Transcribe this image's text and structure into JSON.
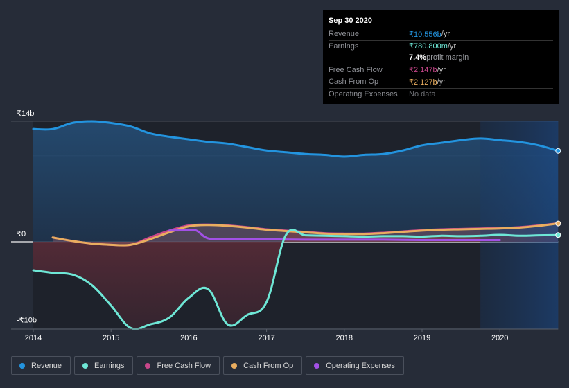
{
  "tooltip": {
    "date": "Sep 30 2020",
    "rows": [
      {
        "label": "Revenue",
        "value": "₹10.556b",
        "unit": " /yr",
        "color": "#2394df"
      },
      {
        "label": "Earnings",
        "value": "₹780.800m",
        "unit": " /yr",
        "color": "#6ee7d6"
      },
      {
        "label": "",
        "value": "7.4%",
        "unit": " profit margin",
        "color": "#ffffff"
      },
      {
        "label": "Free Cash Flow",
        "value": "₹2.147b",
        "unit": " /yr",
        "color": "#c8468a"
      },
      {
        "label": "Cash From Op",
        "value": "₹2.127b",
        "unit": " /yr",
        "color": "#e9ad5f"
      },
      {
        "label": "Operating Expenses",
        "value": "No data",
        "unit": "",
        "color": "#6c6e73"
      }
    ]
  },
  "legend": [
    {
      "label": "Revenue",
      "color": "#2394df"
    },
    {
      "label": "Earnings",
      "color": "#6ee7d6"
    },
    {
      "label": "Free Cash Flow",
      "color": "#c8468a"
    },
    {
      "label": "Cash From Op",
      "color": "#e9ad5f"
    },
    {
      "label": "Operating Expenses",
      "color": "#a250e6"
    }
  ],
  "chart_data": {
    "type": "line",
    "title": "",
    "xlabel": "",
    "ylabel": "",
    "ylim": [
      -10,
      14
    ],
    "xlim": [
      2014,
      2020.75
    ],
    "y_ticks": [
      {
        "value": 14,
        "label": "₹14b"
      },
      {
        "value": 0,
        "label": "₹0"
      },
      {
        "value": -10,
        "label": "-₹10b"
      }
    ],
    "x_ticks": [
      {
        "value": 2014,
        "label": "2014"
      },
      {
        "value": 2015,
        "label": "2015"
      },
      {
        "value": 2016,
        "label": "2016"
      },
      {
        "value": 2017,
        "label": "2017"
      },
      {
        "value": 2018,
        "label": "2018"
      },
      {
        "value": 2019,
        "label": "2019"
      },
      {
        "value": 2020,
        "label": "2020"
      }
    ],
    "forecast_start": 2019.75,
    "series": [
      {
        "name": "Revenue",
        "color": "#2394df",
        "unit": "₹b",
        "x": [
          2014,
          2014.25,
          2014.5,
          2014.75,
          2015,
          2015.25,
          2015.5,
          2015.75,
          2016,
          2016.25,
          2016.5,
          2016.75,
          2017,
          2017.25,
          2017.5,
          2017.75,
          2018,
          2018.25,
          2018.5,
          2018.75,
          2019,
          2019.25,
          2019.5,
          2019.75,
          2020,
          2020.25,
          2020.5,
          2020.75
        ],
        "values": [
          13.1,
          13.1,
          13.8,
          14.0,
          13.8,
          13.4,
          12.6,
          12.2,
          11.9,
          11.6,
          11.4,
          11.0,
          10.6,
          10.4,
          10.2,
          10.1,
          9.9,
          10.1,
          10.2,
          10.6,
          11.2,
          11.5,
          11.8,
          12.0,
          11.8,
          11.6,
          11.2,
          10.556
        ]
      },
      {
        "name": "Earnings",
        "color": "#6ee7d6",
        "unit": "₹b",
        "x": [
          2014,
          2014.25,
          2014.5,
          2014.75,
          2015,
          2015.25,
          2015.5,
          2015.75,
          2016,
          2016.25,
          2016.5,
          2016.75,
          2017,
          2017.25,
          2017.5,
          2017.75,
          2018,
          2018.25,
          2018.5,
          2018.75,
          2019,
          2019.25,
          2019.5,
          2019.75,
          2020,
          2020.25,
          2020.5,
          2020.75
        ],
        "values": [
          -3.3,
          -3.6,
          -3.8,
          -5.0,
          -7.4,
          -10.0,
          -9.6,
          -8.8,
          -6.5,
          -5.5,
          -9.6,
          -8.5,
          -7.0,
          0.8,
          0.75,
          0.7,
          0.65,
          0.6,
          0.65,
          0.65,
          0.6,
          0.7,
          0.65,
          0.7,
          0.8,
          0.7,
          0.75,
          0.78
        ]
      },
      {
        "name": "Free Cash Flow",
        "color": "#c8468a",
        "unit": "₹b",
        "x": [
          2014.25,
          2014.5,
          2014.75,
          2015,
          2015.25,
          2015.5,
          2015.75,
          2016,
          2016.25,
          2016.5,
          2016.75,
          2017,
          2017.25,
          2017.5,
          2017.75,
          2018,
          2018.25,
          2018.5,
          2018.75,
          2019,
          2019.25,
          2019.5,
          2019.75,
          2020,
          2020.25,
          2020.5,
          2020.75
        ],
        "values": [
          0.5,
          0.1,
          -0.2,
          -0.35,
          -0.35,
          0.5,
          1.3,
          1.9,
          2.0,
          1.9,
          1.7,
          1.45,
          1.3,
          1.15,
          1.0,
          0.95,
          0.95,
          1.05,
          1.2,
          1.35,
          1.45,
          1.5,
          1.55,
          1.6,
          1.7,
          1.9,
          2.147
        ]
      },
      {
        "name": "Cash From Op",
        "color": "#e9ad5f",
        "unit": "₹b",
        "x": [
          2014.25,
          2014.5,
          2014.75,
          2015,
          2015.25,
          2015.5,
          2015.75,
          2016,
          2016.25,
          2016.5,
          2016.75,
          2017,
          2017.25,
          2017.5,
          2017.75,
          2018,
          2018.25,
          2018.5,
          2018.75,
          2019,
          2019.25,
          2019.5,
          2019.75,
          2020,
          2020.25,
          2020.5,
          2020.75
        ],
        "values": [
          0.5,
          0.1,
          -0.2,
          -0.35,
          -0.35,
          0.3,
          1.1,
          1.8,
          1.95,
          1.85,
          1.65,
          1.4,
          1.25,
          1.1,
          0.95,
          0.9,
          0.9,
          1.0,
          1.15,
          1.3,
          1.4,
          1.45,
          1.5,
          1.55,
          1.65,
          1.85,
          2.127
        ]
      },
      {
        "name": "Operating Expenses",
        "color": "#a250e6",
        "unit": "₹b",
        "x": [
          2015.75,
          2016,
          2016.1,
          2016.25,
          2016.5,
          2017,
          2017.5,
          2018,
          2018.5,
          2019,
          2019.5,
          2020
        ],
        "values": [
          1.3,
          1.35,
          1.3,
          0.4,
          0.35,
          0.3,
          0.25,
          0.25,
          0.25,
          0.2,
          0.2,
          0.2
        ]
      }
    ]
  }
}
